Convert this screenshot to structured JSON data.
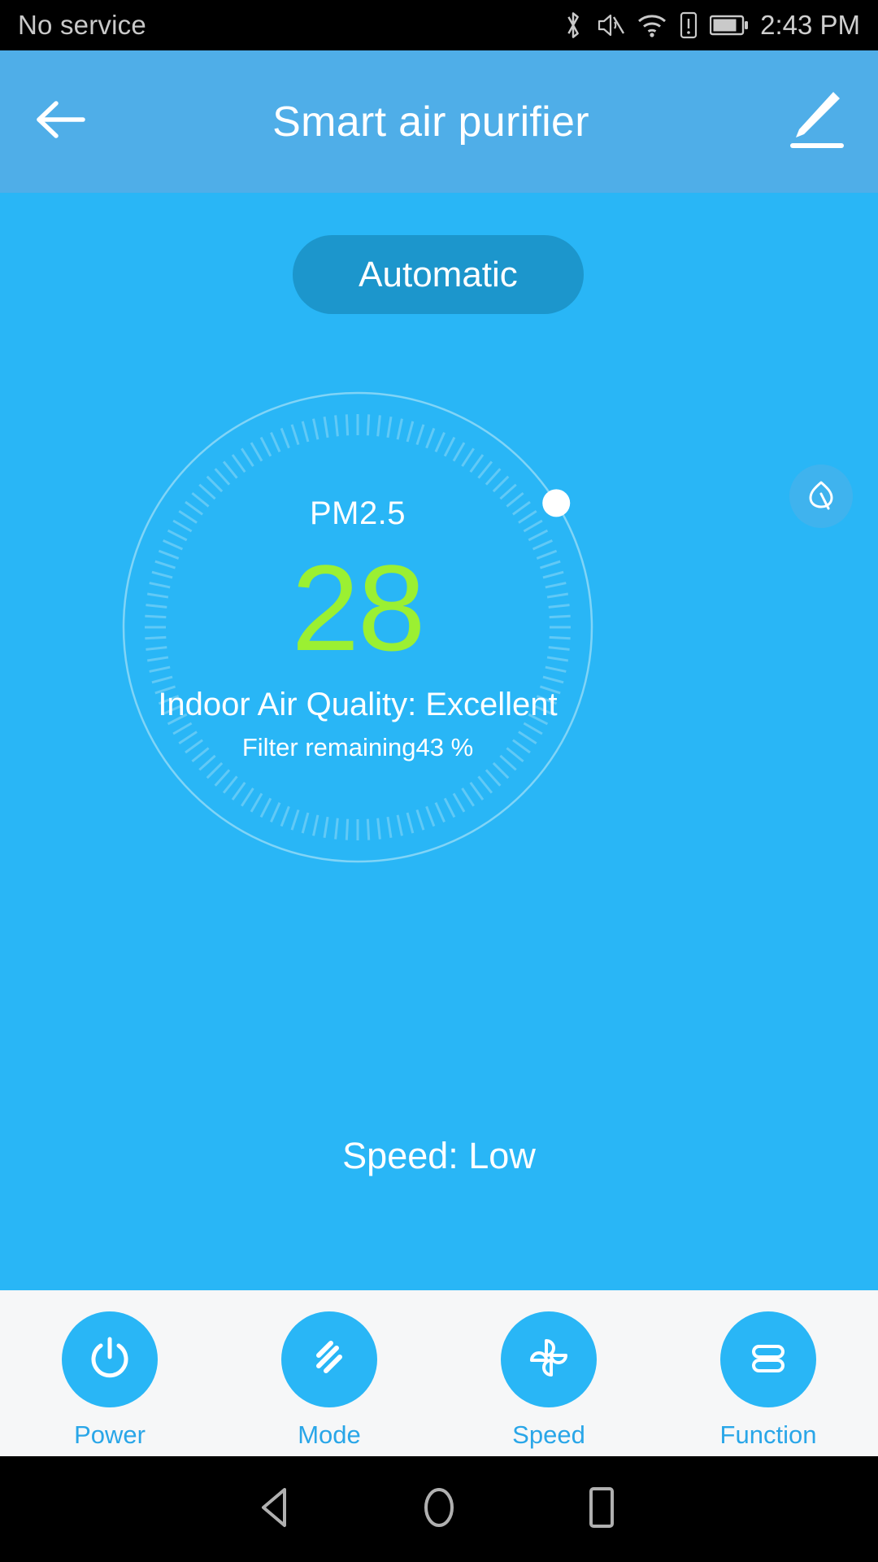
{
  "status_bar": {
    "carrier": "No service",
    "clock": "2:43 PM",
    "icons": [
      "bluetooth-icon",
      "volume-mute-icon",
      "wifi-icon",
      "sim-alert-icon",
      "battery-icon"
    ]
  },
  "app_bar": {
    "title": "Smart air purifier",
    "back_icon": "back-arrow-icon",
    "edit_icon": "pencil-edit-icon"
  },
  "main": {
    "mode_pill_label": "Automatic",
    "leaf_icon": "leaf-icon",
    "gauge": {
      "metric_label": "PM2.5",
      "metric_value": "28",
      "air_quality_text": "Indoor Air Quality: Excellent",
      "filter_text": "Filter remaining43 %",
      "value_color": "#9BF032",
      "ring_color": "#8FD9F7",
      "handle_color": "#FFFFFF",
      "tick_count": 120,
      "handle_angle_deg": 58
    },
    "speed_line": "Speed: Low"
  },
  "toolbar": {
    "items": [
      {
        "label": "Power",
        "icon": "power-icon"
      },
      {
        "label": "Mode",
        "icon": "mode-lines-icon"
      },
      {
        "label": "Speed",
        "icon": "fan-pinwheel-icon"
      },
      {
        "label": "Function",
        "icon": "function-bars-icon"
      }
    ],
    "accent": "#29B6F6",
    "label_color": "#29A6E8",
    "background": "#F6F7F8"
  },
  "nav_bar": {
    "back": "nav-back-triangle-icon",
    "home": "nav-home-circle-icon",
    "recents": "nav-recents-square-icon"
  },
  "theme": {
    "page_blue": "#29B6F6",
    "appbar_blue": "#4FAEE8",
    "pill_blue": "#1C96CC"
  }
}
